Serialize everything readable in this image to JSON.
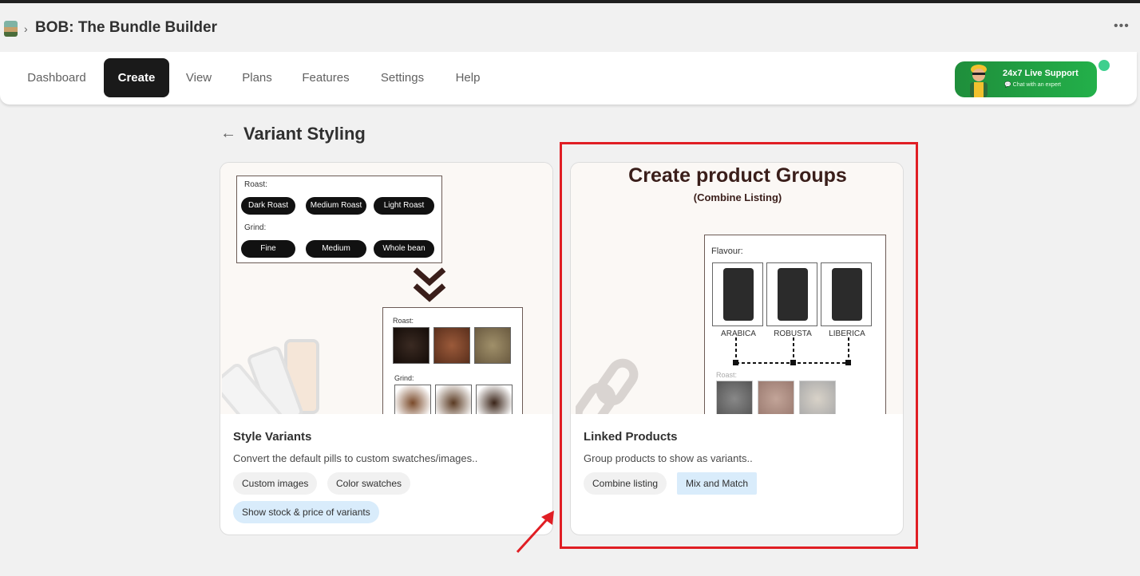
{
  "app": {
    "title": "BOB: The Bundle Builder"
  },
  "nav": {
    "items": [
      {
        "label": "Dashboard",
        "active": false
      },
      {
        "label": "Create",
        "active": true
      },
      {
        "label": "View",
        "active": false
      },
      {
        "label": "Plans",
        "active": false
      },
      {
        "label": "Features",
        "active": false
      },
      {
        "label": "Settings",
        "active": false
      },
      {
        "label": "Help",
        "active": false
      }
    ]
  },
  "support": {
    "title": "24x7 Live Support",
    "subtitle": "Chat with an expert"
  },
  "page": {
    "title": "Variant Styling",
    "back_icon": "arrow-left-icon"
  },
  "cards": [
    {
      "title": "Style Variants",
      "description": "Convert the default pills to custom swatches/images..",
      "tags": [
        "Custom images",
        "Color swatches",
        "Show stock & price of variants"
      ],
      "illustration": {
        "roast_label": "Roast:",
        "roast_options": [
          "Dark Roast",
          "Medium Roast",
          "Light Roast"
        ],
        "grind_label": "Grind:",
        "grind_options": [
          "Fine",
          "Medium",
          "Whole bean"
        ],
        "lower_roast_label": "Roast:",
        "lower_grind_label": "Grind:"
      }
    },
    {
      "title": "Linked Products",
      "description": "Group products to show as variants..",
      "tags": [
        "Combine listing",
        "Mix and Match"
      ],
      "illustration": {
        "heading": "Create product Groups",
        "subheading": "(Combine Listing)",
        "flavour_label": "Flavour:",
        "flavours": [
          "ARABICA",
          "ROBUSTA",
          "LIBERICA"
        ],
        "roast_label": "Roast:"
      }
    }
  ],
  "colors": {
    "highlight": "#e01e24",
    "active_nav": "#1a1a1a",
    "support_green": "#23b04a",
    "tag_blue": "#d9ecfb"
  }
}
